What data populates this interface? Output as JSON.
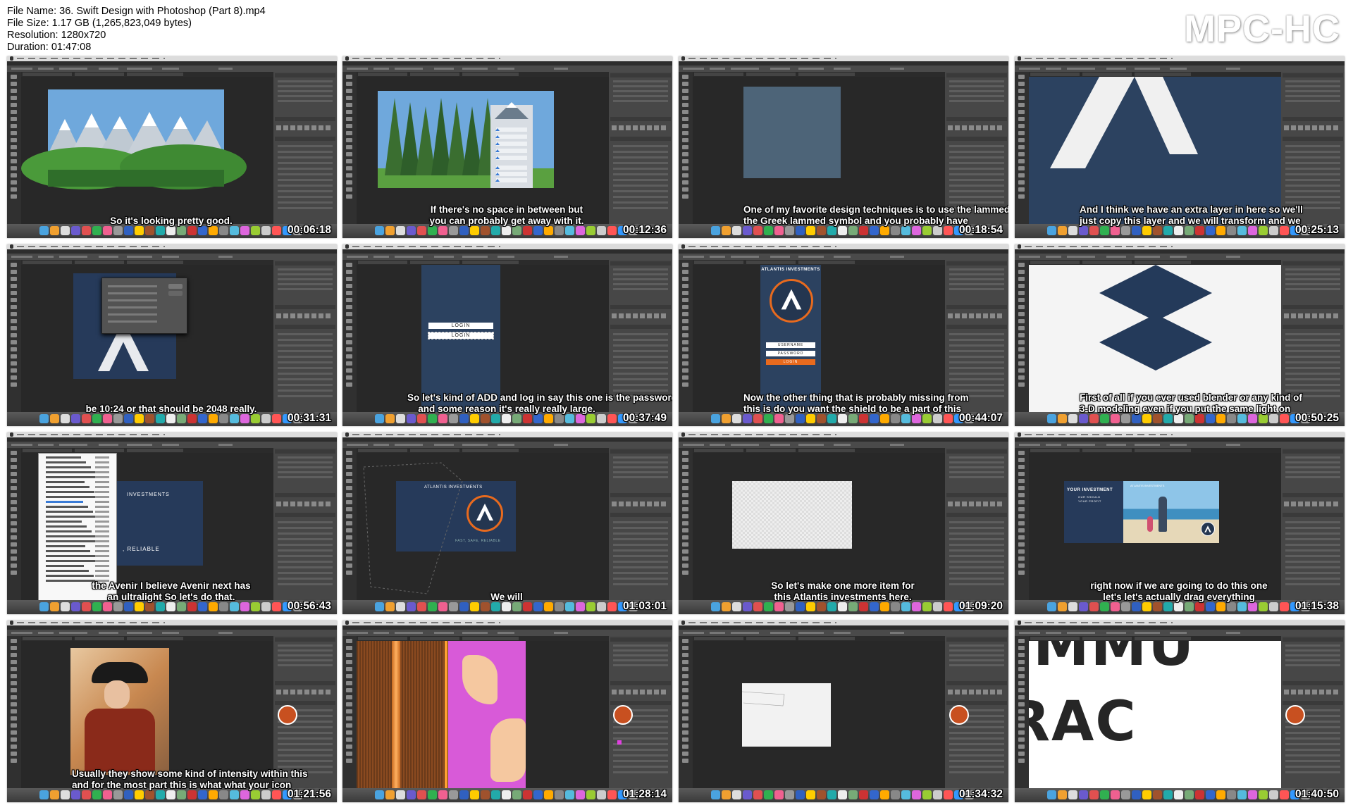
{
  "file_info": {
    "file_name": "File Name: 36. Swift Design with Photoshop (Part 8).mp4",
    "file_size": "File Size: 1.17 GB (1,265,823,049 bytes)",
    "resolution": "Resolution: 1280x720",
    "duration": "Duration: 01:47:08"
  },
  "brand": "MPC-HC",
  "thumbnails": [
    {
      "timestamp": "00:06:18",
      "subtitle": [
        "So it's looking pretty good."
      ]
    },
    {
      "timestamp": "00:12:36",
      "subtitle": [
        "If there's no space in between but",
        "you can probably get away with it."
      ]
    },
    {
      "timestamp": "00:18:54",
      "subtitle": [
        "One of my favorite design techniques is to use the lammed",
        "the Greek lammed symbol and you probably have"
      ]
    },
    {
      "timestamp": "00:25:13",
      "subtitle": [
        "And I think we have an extra layer in here so we'll",
        "just copy this layer and we will transform and we"
      ]
    },
    {
      "timestamp": "00:31:31",
      "subtitle": [
        "be 10:24 or that should be 2048 really."
      ]
    },
    {
      "timestamp": "00:37:49",
      "subtitle": [
        "So let's kind of ADD and log in say this one is the password",
        "and some reason it's really really large."
      ]
    },
    {
      "timestamp": "00:44:07",
      "subtitle": [
        "Now the other thing that is probably missing from",
        "this is do you want the shield to be a part of this"
      ]
    },
    {
      "timestamp": "00:50:25",
      "subtitle": [
        "First of all if you ever used blender or any kind of",
        "3-D modeling even if you put the same light on"
      ]
    },
    {
      "timestamp": "00:56:43",
      "subtitle": [
        "the Avenir I believe Avenir next has",
        "an ultralight So let's do that."
      ]
    },
    {
      "timestamp": "01:03:01",
      "subtitle": [
        "We will"
      ]
    },
    {
      "timestamp": "01:09:20",
      "subtitle": [
        "So let's make one more item for",
        "this Atlantis investments here."
      ]
    },
    {
      "timestamp": "01:15:38",
      "subtitle": [
        "right now if we are going to do this one",
        "let's let's actually drag everything"
      ]
    },
    {
      "timestamp": "01:21:56",
      "subtitle": [
        "Usually they show some kind of intensity within this",
        "and for the most part this is what what your icon"
      ]
    },
    {
      "timestamp": "01:28:14",
      "subtitle": []
    },
    {
      "timestamp": "01:34:32",
      "subtitle": []
    },
    {
      "timestamp": "01:40:50",
      "subtitle": []
    }
  ],
  "canvas_text": {
    "login": "LOGIN",
    "atlantis": "ATLANTIS INVESTMENTS",
    "username": "USERNAME",
    "password": "PASSWORD",
    "investments": "INVESTMENTS",
    "reliable": ", RELIABLE",
    "your_investment": "YOUR INVESTMENT",
    "our_should": "OUR SHOULD",
    "your_profit": "YOUR PROFIT",
    "fast_safe": "FAST, SAFE, RELIABLE",
    "mmu": "MMU",
    "rac": "RAC"
  },
  "colors": {
    "navy": "#263a5a",
    "orange": "#e86a1e",
    "sky": "#6fa8dc",
    "magenta": "#d85ad8"
  }
}
